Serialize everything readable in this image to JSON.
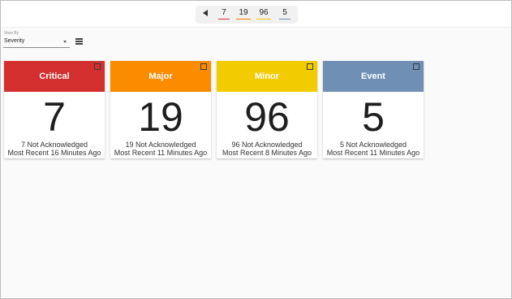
{
  "summary": {
    "counts": [
      {
        "value": "7",
        "color": "#d32f2f"
      },
      {
        "value": "19",
        "color": "#f57c00"
      },
      {
        "value": "96",
        "color": "#f2c500"
      },
      {
        "value": "5",
        "color": "#6f8fb5"
      }
    ]
  },
  "view_by": {
    "label": "View By",
    "selected": "Severity",
    "icons": {
      "dropdown": "caret-down-icon",
      "list": "list-icon"
    }
  },
  "cards": [
    {
      "title": "Critical",
      "count": "7",
      "not_ack": "7 Not Acknowledged",
      "recent": "Most Recent 16 Minutes Ago",
      "color": "#d32f2f"
    },
    {
      "title": "Major",
      "count": "19",
      "not_ack": "19 Not Acknowledged",
      "recent": "Most Recent 11 Minutes Ago",
      "color": "#fb8c00"
    },
    {
      "title": "Minor",
      "count": "96",
      "not_ack": "96 Not Acknowledged",
      "recent": "Most Recent 8 Minutes Ago",
      "color": "#f2cc00"
    },
    {
      "title": "Event",
      "count": "5",
      "not_ack": "5 Not Acknowledged",
      "recent": "Most Recent 11 Minutes Ago",
      "color": "#6f8fb5"
    }
  ]
}
